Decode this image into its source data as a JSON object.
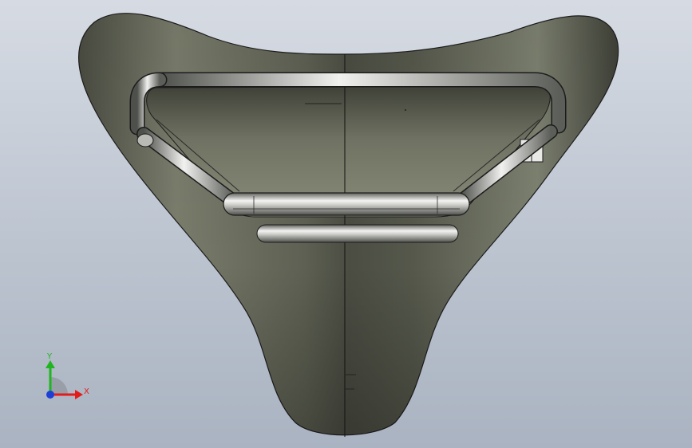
{
  "viewport": {
    "background_top": "#d6dbe3",
    "background_bottom": "#aab3c1"
  },
  "model": {
    "body_color": "#6f7364",
    "rail_color": "#e8e9e6",
    "edge_color": "#1c1c1c"
  },
  "triad": {
    "x_label": "X",
    "y_label": "Y",
    "x_color": "#e31b1b",
    "y_color": "#1fb51f",
    "z_color": "#1d3fd6"
  }
}
